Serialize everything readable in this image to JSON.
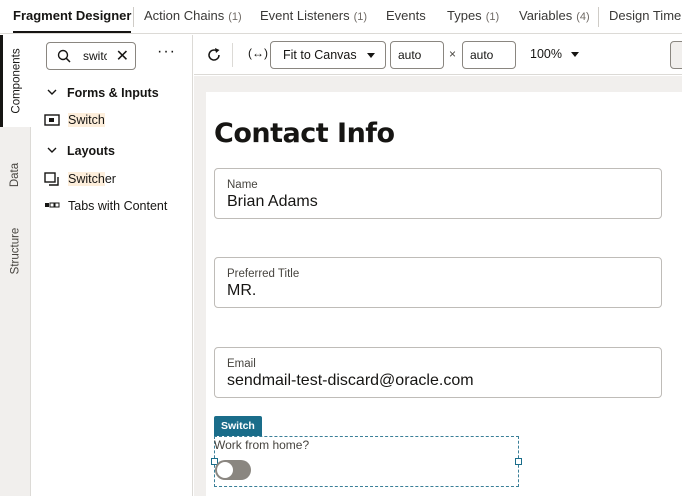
{
  "tabs": [
    {
      "label": "Fragment Designer",
      "count": ""
    },
    {
      "label": "Action Chains",
      "count": "(1)"
    },
    {
      "label": "Event Listeners",
      "count": "(1)"
    },
    {
      "label": "Events",
      "count": ""
    },
    {
      "label": "Types",
      "count": "(1)"
    },
    {
      "label": "Variables",
      "count": "(4)"
    },
    {
      "label": "Design Time",
      "count": ""
    }
  ],
  "side_tabs": [
    "Components",
    "Data",
    "Structure"
  ],
  "components_panel": {
    "search_value": "switch",
    "sections": [
      {
        "label": "Forms & Inputs",
        "items": [
          {
            "label": "Switch",
            "highlight": "Switch",
            "rest": ""
          }
        ]
      },
      {
        "label": "Layouts",
        "items": [
          {
            "label": "Switcher",
            "highlight": "Switch",
            "rest": "er"
          },
          {
            "label": "Tabs with Content",
            "highlight": "",
            "rest": "Tabs with Content"
          }
        ]
      }
    ]
  },
  "toolbar": {
    "responsive_icon": "(↔)",
    "fit_label": "Fit to Canvas",
    "width_value": "auto",
    "height_value": "auto",
    "times": "×",
    "zoom": "100%"
  },
  "form": {
    "title": "Contact Info",
    "fields": [
      {
        "label": "Name",
        "value": "Brian Adams"
      },
      {
        "label": "Preferred Title",
        "value": "MR."
      },
      {
        "label": "Email",
        "value": "sendmail-test-discard@oracle.com"
      }
    ],
    "switch_tag": "Switch",
    "switch_label": "Work from home?",
    "switch_on": false
  },
  "colors": {
    "accent": "#1a6d8a",
    "highlight": "#fdeedb",
    "canvas_bg": "#f1efed"
  }
}
